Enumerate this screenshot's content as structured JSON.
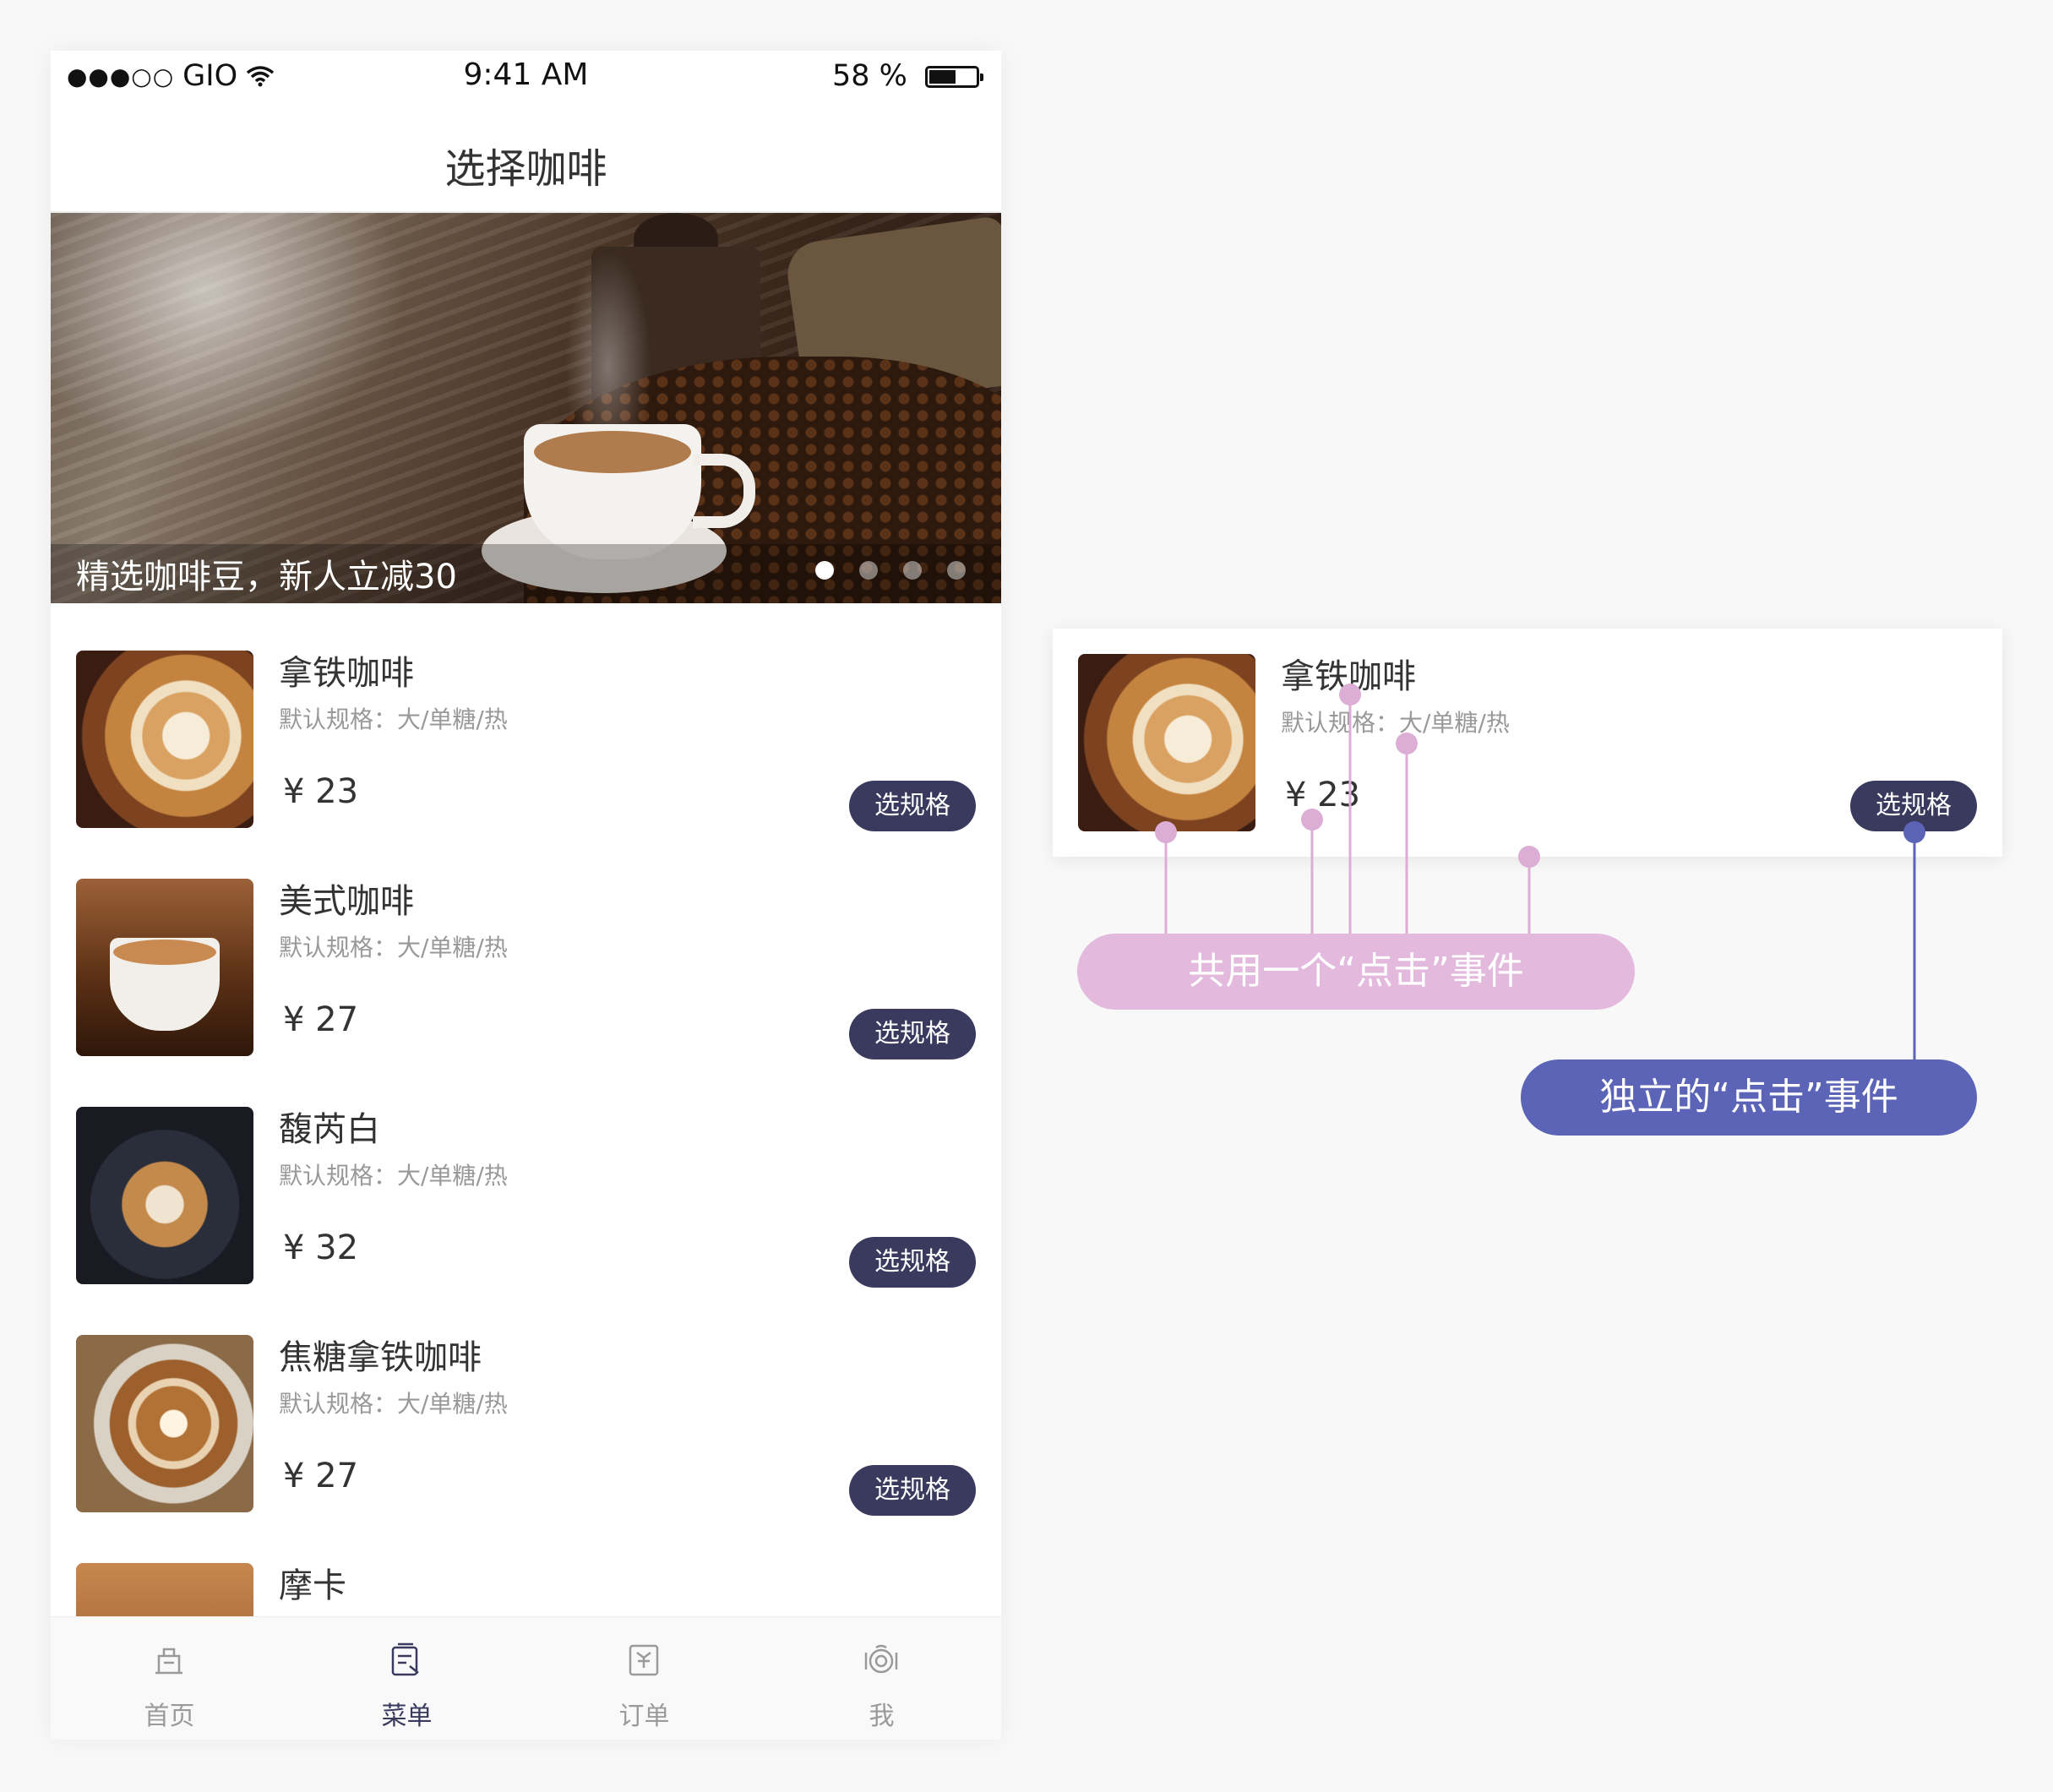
{
  "status_bar": {
    "signal": "●●●○○",
    "carrier": "GIO",
    "time": "9:41 AM",
    "battery_text": "58 %",
    "battery_level": 0.58
  },
  "nav": {
    "title": "选择咖啡"
  },
  "banner": {
    "caption": "精选咖啡豆，新人立减30",
    "page_count": 4,
    "active_page": 1
  },
  "products": [
    {
      "name": "拿铁咖啡",
      "spec": "默认规格：大/单糖/热",
      "price": "¥ 23",
      "button": "选规格",
      "image": "latte-art-cup"
    },
    {
      "name": "美式咖啡",
      "spec": "默认规格：大/单糖/热",
      "price": "¥ 27",
      "button": "选规格",
      "image": "americano-cup-on-beans"
    },
    {
      "name": "馥芮白",
      "spec": "默认规格：大/单糖/热",
      "price": "¥ 32",
      "button": "选规格",
      "image": "flat-white-pouring"
    },
    {
      "name": "焦糖拿铁咖啡",
      "spec": "默认规格：大/单糖/热",
      "price": "¥ 27",
      "button": "选规格",
      "image": "caramel-latte-heart"
    },
    {
      "name": "摩卡",
      "image": "mocha-cup"
    }
  ],
  "tabs": [
    {
      "label": "首页",
      "icon": "home-icon",
      "active": false
    },
    {
      "label": "菜单",
      "icon": "menu-icon",
      "active": true
    },
    {
      "label": "订单",
      "icon": "order-icon",
      "active": false
    },
    {
      "label": "我",
      "icon": "profile-icon",
      "active": false
    }
  ],
  "annotation": {
    "card": {
      "name": "拿铁咖啡",
      "spec": "默认规格：大/单糖/热",
      "price": "¥ 23",
      "button": "选规格"
    },
    "shared_label": "共用一个“点击”事件",
    "independent_label": "独立的“点击”事件",
    "colors": {
      "shared": "#e3b9dd",
      "shared_dot": "#dcaed6",
      "independent": "#5b64b6",
      "button": "#3a395e"
    }
  }
}
